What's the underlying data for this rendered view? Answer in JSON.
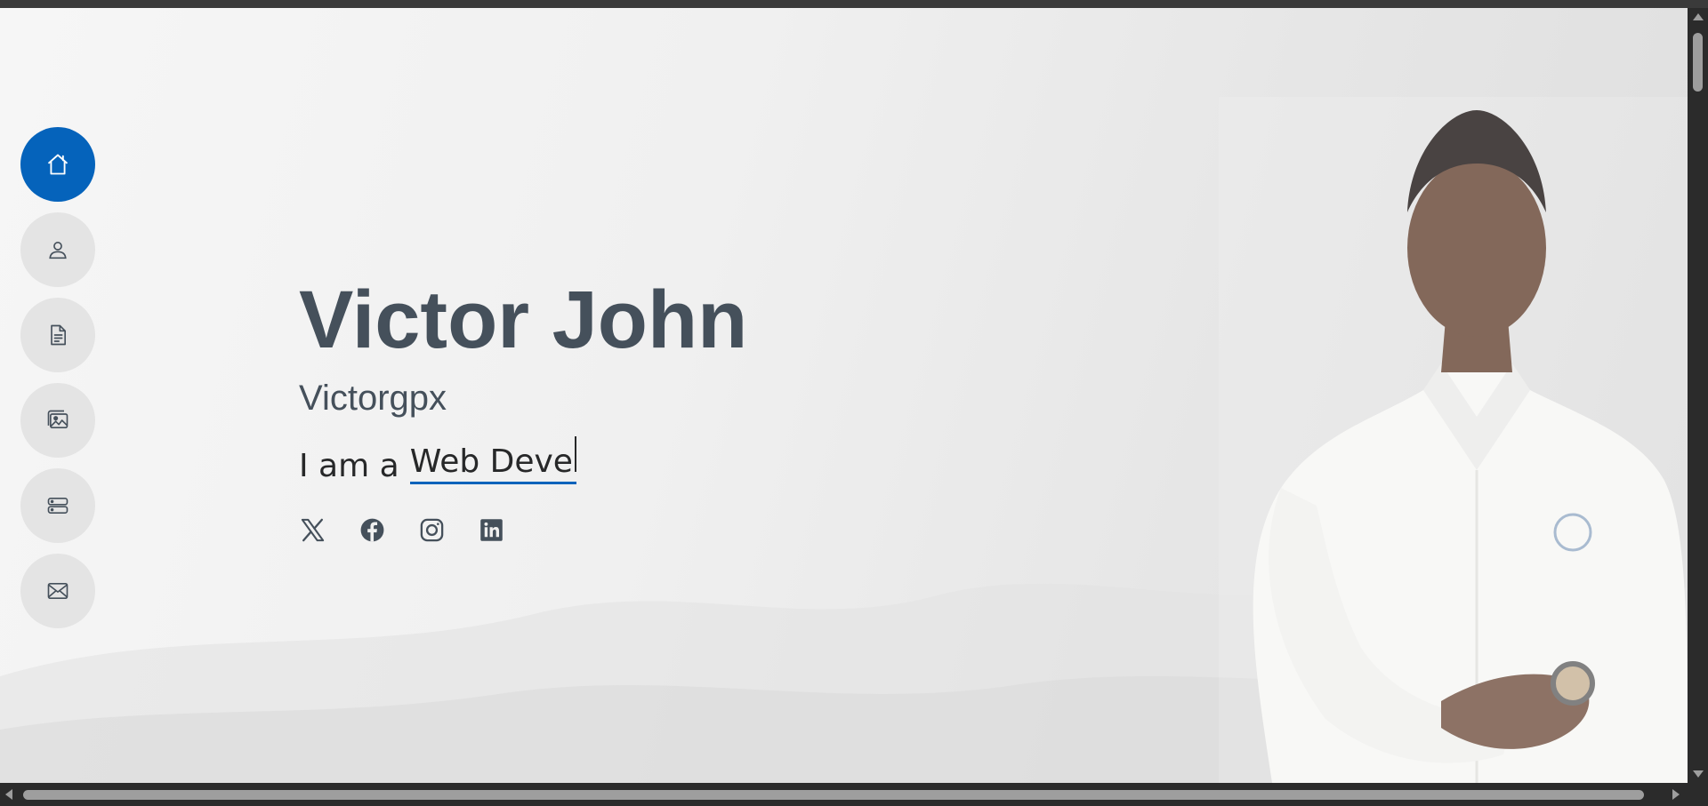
{
  "profile": {
    "name": "Victor John",
    "handle": "Victorgpx",
    "typed_prefix": "I am a",
    "typed_text": "Web Deve"
  },
  "nav": {
    "items": [
      {
        "icon": "home-icon",
        "active": true
      },
      {
        "icon": "person-icon",
        "active": false
      },
      {
        "icon": "file-text-icon",
        "active": false
      },
      {
        "icon": "images-icon",
        "active": false
      },
      {
        "icon": "server-icon",
        "active": false
      },
      {
        "icon": "envelope-icon",
        "active": false
      }
    ]
  },
  "social": {
    "items": [
      {
        "icon": "x-twitter-icon"
      },
      {
        "icon": "facebook-icon"
      },
      {
        "icon": "instagram-icon"
      },
      {
        "icon": "linkedin-icon"
      }
    ]
  },
  "colors": {
    "accent": "#0563bb",
    "heading": "#45505b",
    "text": "#272829"
  }
}
